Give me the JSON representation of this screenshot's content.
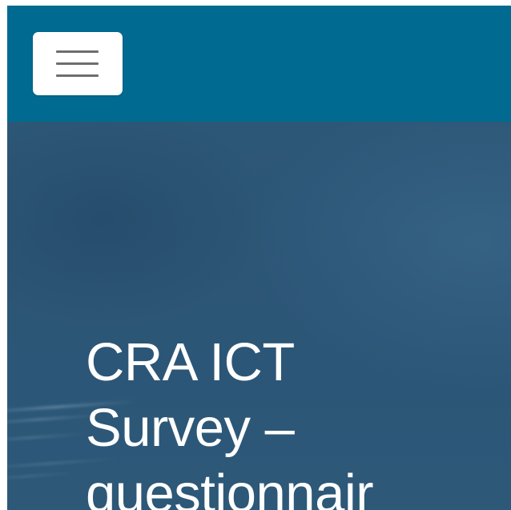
{
  "header": {
    "menu_button": {
      "icon": "hamburger-menu-icon"
    }
  },
  "hero": {
    "title": "CRA ICT\nSurvey –\nquestionnair"
  },
  "colors": {
    "header_bg": "#006a90",
    "hero_bg": "#2c5576",
    "title_text": "#ffffff",
    "menu_button_bg": "#ffffff",
    "menu_icon": "#6e6e6e"
  }
}
